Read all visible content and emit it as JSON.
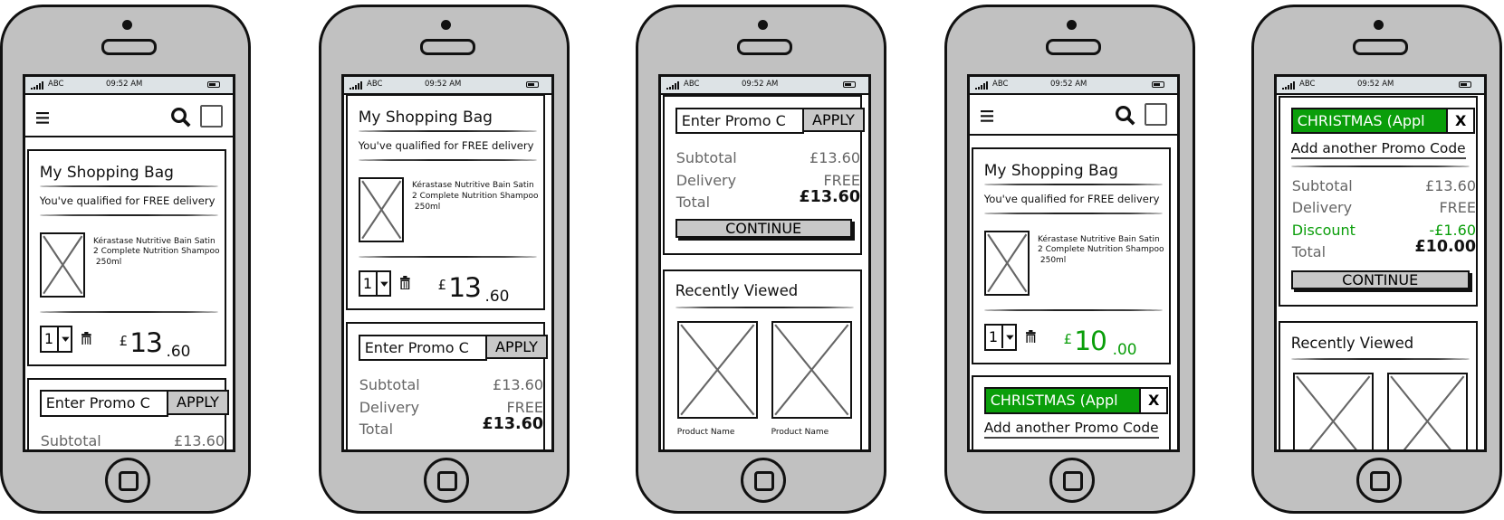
{
  "status": {
    "carrier": "ABC",
    "time": "09:52 AM"
  },
  "colors": {
    "discount_green": "#0a9e0a",
    "placeholder_gray": "#c8c8c8",
    "status_bar": "#dde3e6"
  },
  "icons": {
    "menu": "hamburger-icon",
    "search": "search-icon",
    "bag": "bag-square-icon",
    "delete": "trash-icon",
    "qty_dropdown": "chevron-down-icon"
  },
  "phones": [
    {
      "nav": true,
      "bag": {
        "title": "My Shopping Bag",
        "delivery_note": "You've qualified for FREE delivery",
        "product_lines": [
          "Kérastase Nutritive Bain Satin",
          "2 Complete Nutrition Shampoo",
          " 250ml"
        ],
        "qty": "1",
        "currency": "£",
        "price_major": "13",
        "price_minor": ".60",
        "price_color": "#111111"
      },
      "promo": {
        "placeholder": "Enter Promo C",
        "apply_label": "APPLY",
        "rows": [
          {
            "label": "Subtotal",
            "value": "£13.60"
          }
        ]
      }
    },
    {
      "bag": {
        "title": "My Shopping Bag",
        "delivery_note": "You've qualified for FREE delivery",
        "product_lines": [
          "Kérastase Nutritive Bain Satin",
          "2 Complete Nutrition Shampoo",
          " 250ml"
        ],
        "qty": "1",
        "currency": "£",
        "price_major": "13",
        "price_minor": ".60",
        "price_color": "#111111"
      },
      "promo": {
        "placeholder": "Enter Promo C",
        "apply_label": "APPLY",
        "rows": [
          {
            "label": "Subtotal",
            "value": "£13.60"
          },
          {
            "label": "Delivery",
            "value": "FREE"
          },
          {
            "label": "Total",
            "value": "£13.60",
            "total": true
          }
        ]
      }
    },
    {
      "promo": {
        "placeholder": "Enter Promo C",
        "apply_label": "APPLY",
        "rows": [
          {
            "label": "Subtotal",
            "value": "£13.60"
          },
          {
            "label": "Delivery",
            "value": "FREE"
          },
          {
            "label": "Total",
            "value": "£13.60",
            "total": true
          }
        ],
        "continue_label": "CONTINUE"
      },
      "recent": {
        "title": "Recently Viewed",
        "products": [
          "Product Name",
          "Product Name"
        ]
      }
    },
    {
      "nav": true,
      "bag": {
        "title": "My Shopping Bag",
        "delivery_note": "You've qualified for FREE delivery",
        "product_lines": [
          "Kérastase Nutritive Bain Satin",
          "2 Complete Nutrition Shampoo",
          " 250ml"
        ],
        "qty": "1",
        "currency": "£",
        "price_major": "10",
        "price_minor": ".00",
        "price_color": "#0a9e0a"
      },
      "applied": {
        "code": "CHRISTMAS (Appl",
        "remove_label": "X",
        "add_another": "Add another Promo Code"
      }
    },
    {
      "applied": {
        "code": "CHRISTMAS (Appl",
        "remove_label": "X",
        "add_another": "Add another Promo Code",
        "rows": [
          {
            "label": "Subtotal",
            "value": "£13.60"
          },
          {
            "label": "Delivery",
            "value": "FREE"
          },
          {
            "label": "Discount",
            "value": "-£1.60",
            "color": "#0a9e0a"
          },
          {
            "label": "Total",
            "value": "£10.00",
            "total": true
          }
        ],
        "continue_label": "CONTINUE"
      },
      "recent": {
        "title": "Recently Viewed",
        "products": []
      }
    }
  ]
}
